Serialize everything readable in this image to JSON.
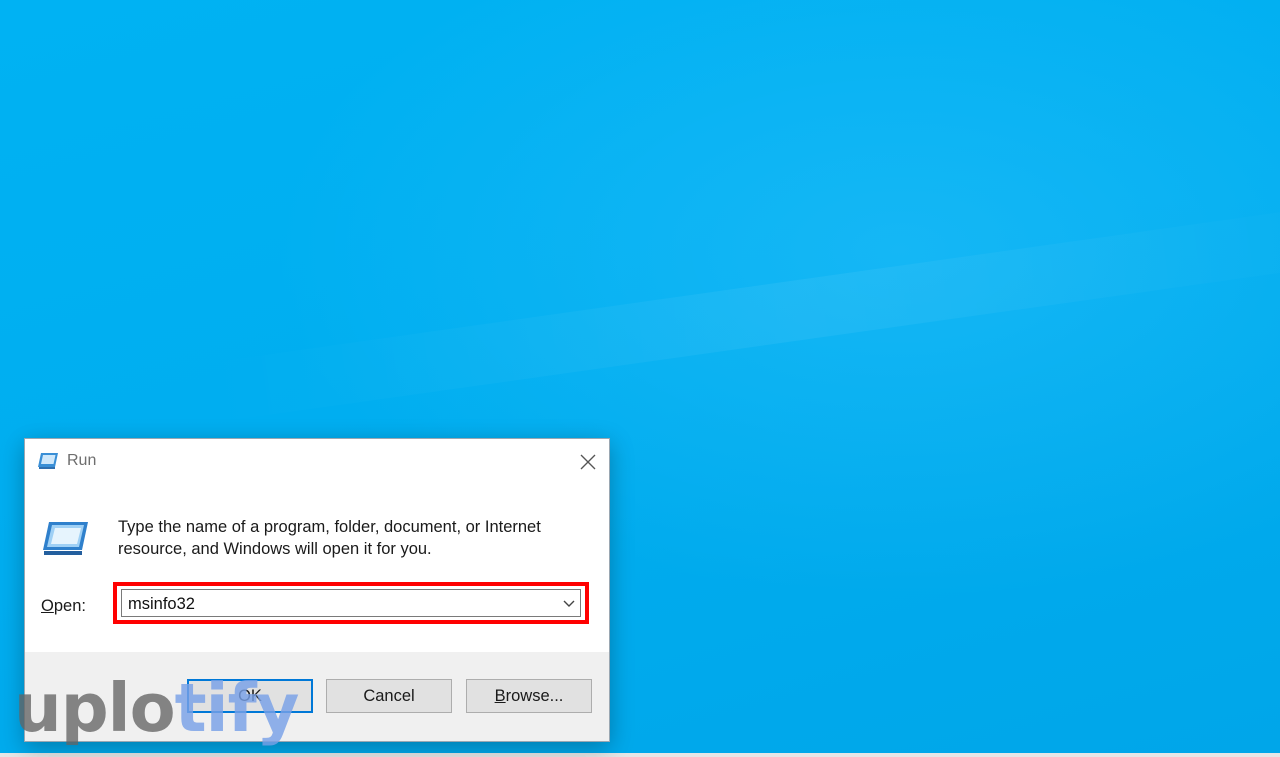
{
  "dialog": {
    "title": "Run",
    "description": "Type the name of a program, folder, document, or Internet resource, and Windows will open it for you.",
    "open_label_accel": "O",
    "open_label_rest": "pen:",
    "input_value": "msinfo32",
    "highlight_color": "#ff0000"
  },
  "buttons": {
    "ok": "OK",
    "cancel": "Cancel",
    "browse_accel": "B",
    "browse_rest": "rowse..."
  },
  "watermark": {
    "part1": "uplo",
    "part2": "tify"
  },
  "colors": {
    "desktop": "#00adef",
    "accent": "#0078d7"
  },
  "icons": {
    "title": "run-icon",
    "body": "run-icon",
    "close": "close-icon",
    "dropdown": "chevron-down-icon"
  }
}
